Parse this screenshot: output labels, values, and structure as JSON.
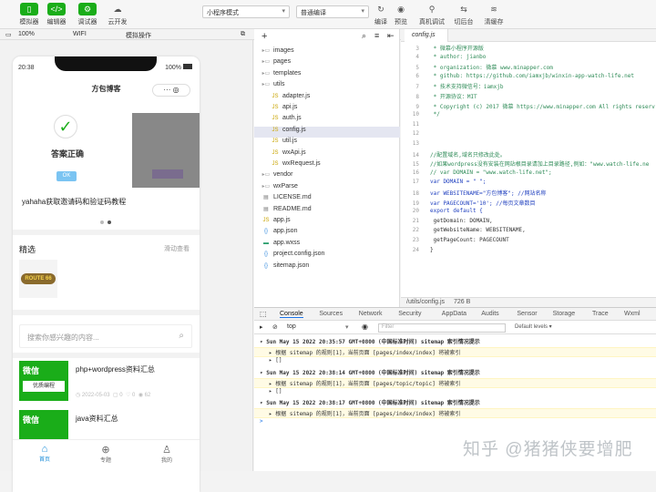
{
  "toolbar": {
    "sim": "模拟器",
    "editor": "编辑器",
    "debugger": "调试器",
    "cloud": "云开发",
    "mode": "小程序模式",
    "compile": "普通编译",
    "btn_compile": "编译",
    "btn_preview": "预览",
    "btn_realdebug": "真机调试",
    "btn_backend": "切后台",
    "btn_clear": "清缓存"
  },
  "simbar": {
    "zoom": "100%",
    "net": "WIFI",
    "ops": "模拟操作"
  },
  "phone": {
    "time": "20:38",
    "battery": "100%",
    "title": "方包博客",
    "modal_text": "答案正确",
    "ok": "OK",
    "caption": "yahaha获取邀请码和验证码教程",
    "section": "精选",
    "more": "滑动查看",
    "search": "搜索你感兴趣的内容...",
    "post1": "php+wordpress资料汇总",
    "post1_tag": "微信",
    "post1_sub": "优质编程",
    "post1_date": "2022-05-03",
    "post1_c1": "0",
    "post1_c2": "0",
    "post1_c3": "62",
    "post2": "java资料汇总",
    "post2_tag": "微信",
    "nav_home": "首页",
    "nav_topic": "专题",
    "nav_me": "我的",
    "badge": "ROUTE 66"
  },
  "files": {
    "items": [
      "images",
      "pages",
      "templates",
      "utils",
      "adapter.js",
      "api.js",
      "auth.js",
      "config.js",
      "util.js",
      "wxApi.js",
      "wxRequest.js",
      "vendor",
      "wxParse",
      "LICENSE.md",
      "README.md",
      "app.js",
      "app.json",
      "app.wxss",
      "project.config.json",
      "sitemap.json"
    ]
  },
  "editor": {
    "tab": "config.js",
    "status_path": "/utils/config.js",
    "status_size": "726 B",
    "lines": [
      {
        "n": "3",
        "t": " * 微慕小程序开源版",
        "c": "cm"
      },
      {
        "n": "4",
        "t": " * author: jianbo",
        "c": "cm"
      },
      {
        "n": "5",
        "t": " * organization: 微慕  www.minapper.com",
        "c": "cm"
      },
      {
        "n": "6",
        "t": " * github:    https://github.com/iamxjb/winxin-app-watch-life.net",
        "c": "cm"
      },
      {
        "n": "7",
        "t": " * 技术支持微信号：iamxjb",
        "c": "cm"
      },
      {
        "n": "8",
        "t": " * 开源协议：MIT",
        "c": "cm"
      },
      {
        "n": "9",
        "t": " * Copyright (c) 2017  微慕 https://www.minapper.com All rights reserv",
        "c": "cm"
      },
      {
        "n": "10",
        "t": " */",
        "c": "cm"
      },
      {
        "n": "11",
        "t": "",
        "c": ""
      },
      {
        "n": "12",
        "t": "",
        "c": ""
      },
      {
        "n": "13",
        "t": "",
        "c": ""
      },
      {
        "n": "14",
        "t": "//配置域名,域名只修改此处。",
        "c": "cm"
      },
      {
        "n": "15",
        "t": "//如果wordpress没有安装在网站根目录请加上目录路径,例如：\"www.watch-life.ne",
        "c": "cm"
      },
      {
        "n": "16",
        "t": "// var DOMAIN = \"www.watch-life.net\";",
        "c": "cm"
      },
      {
        "n": "17",
        "t": "var DOMAIN = \"                 \";",
        "c": "kw"
      },
      {
        "n": "18",
        "t": "var WEBSITENAME=\"方包博客\";  //网站名称",
        "c": "kw"
      },
      {
        "n": "19",
        "t": "var PAGECOUNT='10';  //每页文章数目",
        "c": "kw"
      },
      {
        "n": "20",
        "t": "export default {",
        "c": "kw"
      },
      {
        "n": "21",
        "t": "  getDomain: DOMAIN,",
        "c": ""
      },
      {
        "n": "22",
        "t": "  getWebsiteName: WEBSITENAME,",
        "c": ""
      },
      {
        "n": "23",
        "t": "  getPageCount: PAGECOUNT",
        "c": ""
      },
      {
        "n": "24",
        "t": "}",
        "c": ""
      }
    ]
  },
  "console": {
    "tabs": [
      "Console",
      "Sources",
      "Network",
      "Security",
      "AppData",
      "Audits",
      "Sensor",
      "Storage",
      "Trace",
      "Wxml"
    ],
    "context": "top",
    "filter": "Filter",
    "levels": "Default levels ▾",
    "logs": [
      {
        "h": "▾ Sun May 15 2022 20:35:57 GMT+0800 (中国标准时间) sitemap 索引情况提示",
        "w": "▸ 根据 sitemap 的规则[1]，当前页面 [pages/index/index] 将被索引",
        "e": "▸ []"
      },
      {
        "h": "▾ Sun May 15 2022 20:38:14 GMT+0800 (中国标准时间) sitemap 索引情况提示",
        "w": "▸ 根据 sitemap 的规则[1]，当前页面 [pages/topic/topic] 将被索引",
        "e": "▸ []"
      },
      {
        "h": "▾ Sun May 15 2022 20:38:17 GMT+0800 (中国标准时间) sitemap 索引情况提示",
        "w": "▸ 根据 sitemap 的规则[1]，当前页面 [pages/index/index] 将被索引",
        "e": ">"
      }
    ]
  },
  "watermark": "知乎 @猪猪侠要增肥"
}
